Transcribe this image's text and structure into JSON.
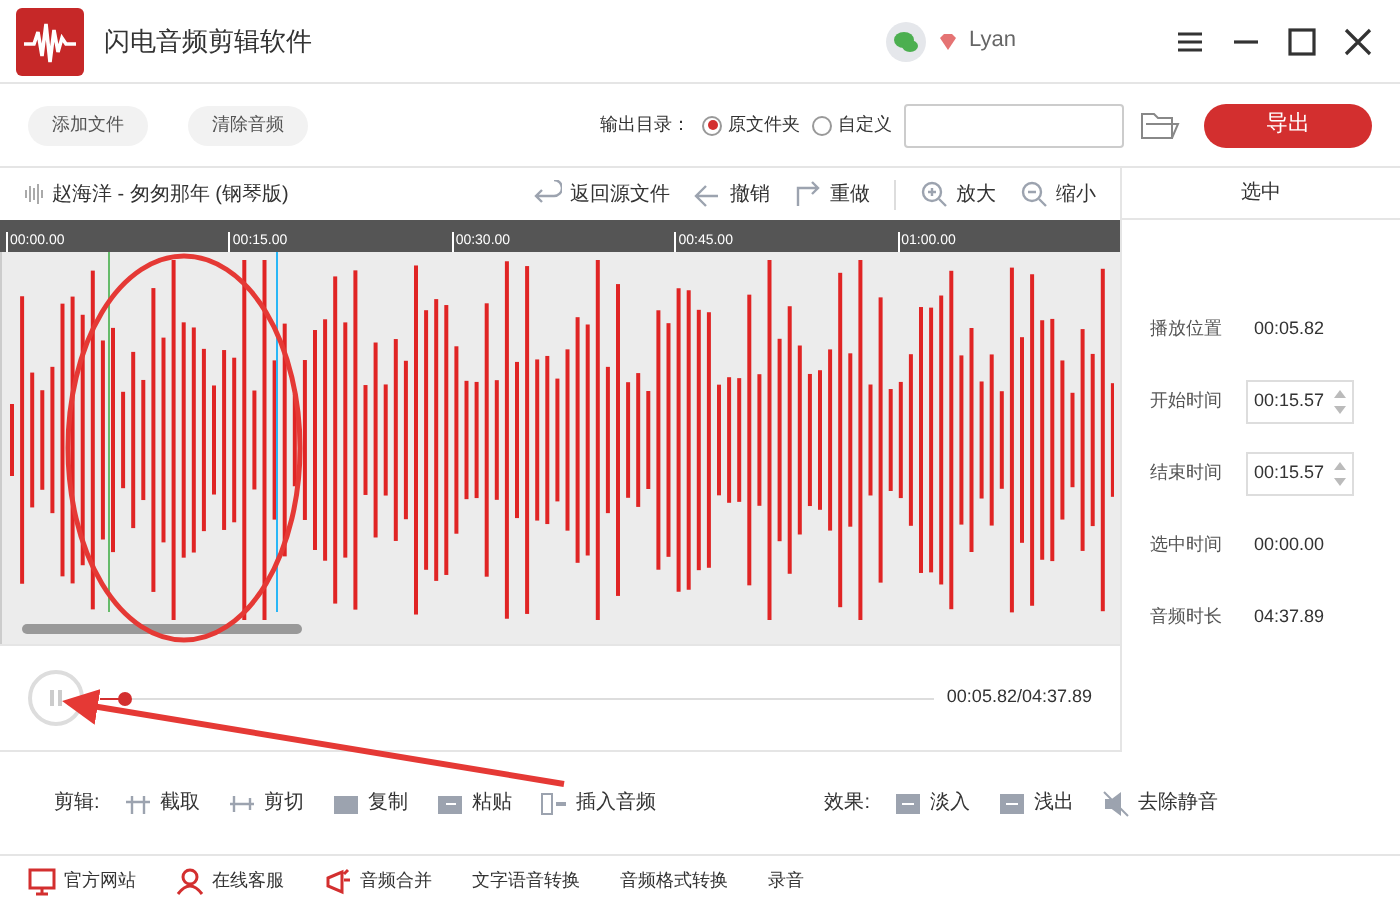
{
  "window": {
    "title": "闪电音频剪辑软件",
    "user": "Lyan"
  },
  "toolbar": {
    "buttons": [
      "添加文件",
      "清除音频"
    ],
    "output_label": "输出目录：",
    "output_options": [
      {
        "label": "原文件夹",
        "selected": true
      },
      {
        "label": "自定义",
        "selected": false
      }
    ],
    "export": "导出"
  },
  "track": {
    "title": "赵海洋 - 匆匆那年 (钢琴版)",
    "actions": [
      "返回源文件",
      "撤销",
      "重做",
      "放大",
      "缩小"
    ]
  },
  "timeline": {
    "ticks": [
      "00:00.00",
      "00:15.00",
      "00:30.00",
      "00:45.00",
      "01:00.00"
    ]
  },
  "selection_panel": {
    "title": "选中",
    "rows": [
      {
        "kind": "text",
        "label": "播放位置",
        "value": "00:05.82"
      },
      {
        "kind": "spin",
        "label": "开始时间",
        "value": "00:15.57"
      },
      {
        "kind": "spin",
        "label": "结束时间",
        "value": "00:15.57"
      },
      {
        "kind": "text",
        "label": "选中时间",
        "value": "00:00.00"
      },
      {
        "kind": "text",
        "label": "音频时长",
        "value": "04:37.89"
      }
    ]
  },
  "player": {
    "playing": true,
    "level": 0.03,
    "time": "00:05.82/04:37.89"
  },
  "edit": {
    "label": "剪辑:",
    "tools": [
      "截取",
      "剪切",
      "复制",
      "粘贴",
      "插入音频"
    ],
    "effects_label": "效果:",
    "effects": [
      "淡入",
      "浅出",
      "去除静音"
    ]
  },
  "footer": [
    "官方网站",
    "在线客服",
    "音频合并",
    "文字语音转换",
    "音频格式转换",
    "录音"
  ]
}
